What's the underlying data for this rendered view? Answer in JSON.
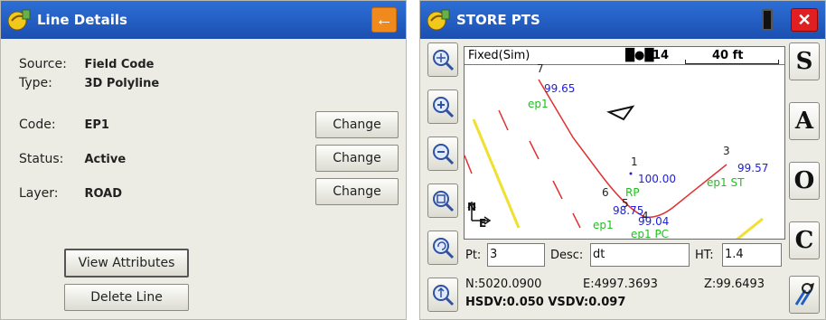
{
  "left": {
    "title": "Line Details",
    "source_label": "Source:",
    "source_value": "Field Code",
    "type_label": "Type:",
    "type_value": "3D Polyline",
    "code_label": "Code:",
    "code_value": "EP1",
    "status_label": "Status:",
    "status_value": "Active",
    "layer_label": "Layer:",
    "layer_value": "ROAD",
    "change_label": "Change",
    "view_attributes_label": "View Attributes",
    "delete_line_label": "Delete Line"
  },
  "right": {
    "title": "STORE PTS",
    "mode": "Fixed(Sim)",
    "satellites": "14",
    "scale": "40 ft",
    "pt_label": "Pt:",
    "pt_value": "3",
    "desc_label": "Desc:",
    "desc_value": "dt",
    "ht_label": "HT:",
    "ht_value": "1.4",
    "northing": "N:5020.0900",
    "easting": "E:4997.3693",
    "elevation": "Z:99.6493",
    "precision": "HSDV:0.050 VSDV:0.097",
    "letters": [
      "S",
      "A",
      "O",
      "C"
    ],
    "map_labels": {
      "p7": "7",
      "v7": "99.65",
      "c7": "ep1",
      "p3": "3",
      "v3": "99.57",
      "c3": "ep1 ST",
      "p1": "1",
      "v1": "100.00",
      "p6": "6",
      "rp": "RP",
      "p5": "5",
      "v6": "98.75",
      "p4": "4",
      "v4": "99.04",
      "c6": "ep1",
      "c4": "ep1 PC",
      "north": "N",
      "east": "E"
    }
  },
  "colors": {
    "titlebar": "#2d6fd6",
    "accent_orange": "#f08a1c",
    "close_red": "#e02020",
    "road_line": "#e03030",
    "point_value": "#2020e0",
    "code_green": "#20c020",
    "yellow_line": "#f0e030"
  }
}
